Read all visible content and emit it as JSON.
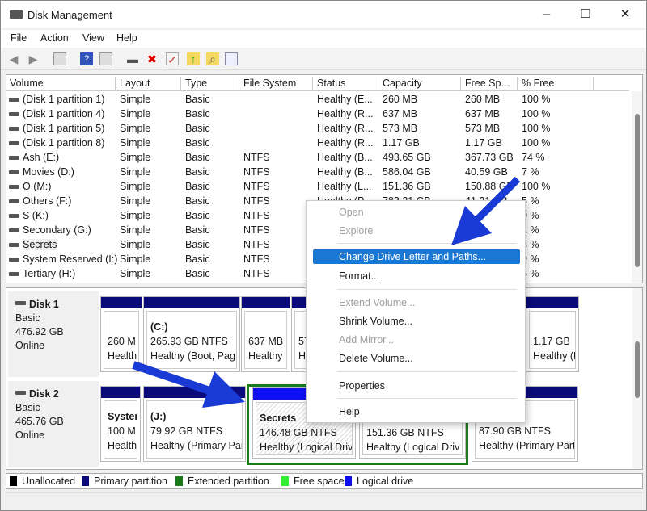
{
  "window": {
    "title": "Disk Management",
    "min": "–",
    "max": "☐",
    "close": "✕"
  },
  "menu": [
    "File",
    "Action",
    "View",
    "Help"
  ],
  "list": {
    "columns": [
      "Volume",
      "Layout",
      "Type",
      "File System",
      "Status",
      "Capacity",
      "Free Sp...",
      "% Free"
    ],
    "rows": [
      [
        "(Disk 1 partition 1)",
        "Simple",
        "Basic",
        "",
        "Healthy (E...",
        "260 MB",
        "260 MB",
        "100 %"
      ],
      [
        "(Disk 1 partition 4)",
        "Simple",
        "Basic",
        "",
        "Healthy (R...",
        "637 MB",
        "637 MB",
        "100 %"
      ],
      [
        "(Disk 1 partition 5)",
        "Simple",
        "Basic",
        "",
        "Healthy (R...",
        "573 MB",
        "573 MB",
        "100 %"
      ],
      [
        "(Disk 1 partition 8)",
        "Simple",
        "Basic",
        "",
        "Healthy (R...",
        "1.17 GB",
        "1.17 GB",
        "100 %"
      ],
      [
        "Ash (E:)",
        "Simple",
        "Basic",
        "NTFS",
        "Healthy (B...",
        "493.65 GB",
        "367.73 GB",
        "74 %"
      ],
      [
        "Movies (D:)",
        "Simple",
        "Basic",
        "NTFS",
        "Healthy (B...",
        "586.04 GB",
        "40.59 GB",
        "7 %"
      ],
      [
        "O (M:)",
        "Simple",
        "Basic",
        "NTFS",
        "Healthy (L...",
        "151.36 GB",
        "150.88 GB",
        "100 %"
      ],
      [
        "Others (F:)",
        "Simple",
        "Basic",
        "NTFS",
        "Healthy (P...",
        "783.21 GB",
        "41.21 GB",
        "5 %"
      ],
      [
        "S (K:)",
        "Simple",
        "Basic",
        "NTFS",
        "",
        "",
        "",
        "0 %"
      ],
      [
        "Secondary (G:)",
        "Simple",
        "Basic",
        "NTFS",
        "",
        "",
        "",
        "2 %"
      ],
      [
        "Secrets",
        "Simple",
        "Basic",
        "NTFS",
        "",
        "",
        "",
        "3 %"
      ],
      [
        "System Reserved (I:)",
        "Simple",
        "Basic",
        "NTFS",
        "",
        "",
        "",
        "9 %"
      ],
      [
        "Tertiary (H:)",
        "Simple",
        "Basic",
        "NTFS",
        "",
        "",
        "",
        "5 %"
      ]
    ]
  },
  "disks": [
    {
      "name": "Disk 1",
      "type": "Basic",
      "size": "476.92 GB",
      "state": "Online",
      "partitions": [
        {
          "title": "",
          "l1": "260 M",
          "l2": "Health"
        },
        {
          "title": "(C:)",
          "l1": "265.93 GB NTFS",
          "l2": "Healthy (Boot, Pag"
        },
        {
          "title": "",
          "l1": "637 MB",
          "l2": "Healthy"
        },
        {
          "title": "",
          "l1": "573 MB",
          "l2": "Healthy"
        },
        {
          "title": "",
          "l1": "1.17 GB",
          "l2": "Healthy (R"
        }
      ]
    },
    {
      "name": "Disk 2",
      "type": "Basic",
      "size": "465.76 GB",
      "state": "Online",
      "partitions": [
        {
          "title": "Syster",
          "l1": "100 M",
          "l2": "Health"
        },
        {
          "title": "(J:)",
          "l1": "79.92 GB NTFS",
          "l2": "Healthy (Primary Par"
        },
        {
          "title": "Secrets",
          "l1": "146.48 GB NTFS",
          "l2": "Healthy (Logical Driv"
        },
        {
          "title": "",
          "l1": "151.36 GB NTFS",
          "l2": "Healthy (Logical Driv"
        },
        {
          "title": "",
          "l1": "87.90 GB NTFS",
          "l2": "Healthy (Primary Part"
        }
      ]
    }
  ],
  "legend": [
    {
      "label": "Unallocated",
      "color": "#000000"
    },
    {
      "label": "Primary partition",
      "color": "#0a0a7a"
    },
    {
      "label": "Extended partition",
      "color": "#1a7a1a"
    },
    {
      "label": "Free space",
      "color": "#33ee33"
    },
    {
      "label": "Logical drive",
      "color": "#1010ee"
    }
  ],
  "context_menu": {
    "open": "Open",
    "explore": "Explore",
    "change": "Change Drive Letter and Paths...",
    "format": "Format...",
    "extend": "Extend Volume...",
    "shrink": "Shrink Volume...",
    "mirror": "Add Mirror...",
    "delete": "Delete Volume...",
    "properties": "Properties",
    "help": "Help"
  },
  "colors": {
    "highlight": "#1a78d4",
    "arrow": "#1a3ad6"
  }
}
